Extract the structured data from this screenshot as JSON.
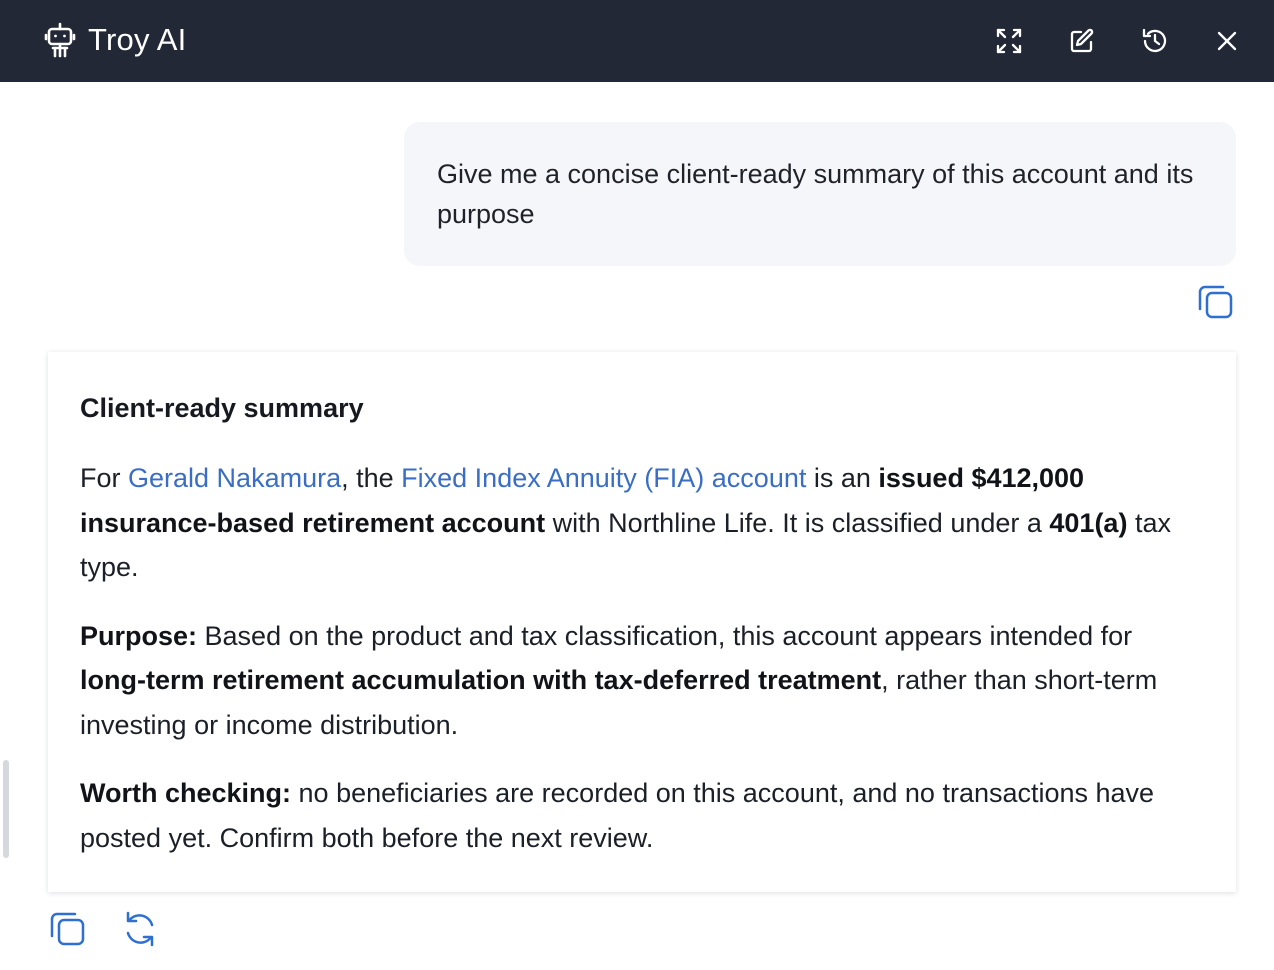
{
  "header": {
    "title": "Troy AI",
    "bg_color": "#222835",
    "icons": [
      "robot-icon",
      "expand-icon",
      "edit-icon",
      "history-icon",
      "close-icon"
    ]
  },
  "user_message": {
    "text": "Give me a concise client-ready summary of this account and its purpose"
  },
  "reply": {
    "heading": "Client-ready summary",
    "p1": {
      "t1": "For ",
      "client_link": "Gerald Nakamura",
      "t2": ", the ",
      "account_link": "Fixed Index Annuity (FIA) account",
      "t3": " is an ",
      "b1": "issued $412,000 insurance-based retirement account",
      "t4": " with Northline Life. It is classified under a ",
      "b2": "401(a)",
      "t5": " tax type."
    },
    "p2": {
      "label": "Purpose:",
      "t1": " Based on the product and tax classification, this account appears intended for ",
      "b1": "long-term retirement accumulation with tax-deferred treatment",
      "t2": ", rather than short-term investing or income distribution."
    },
    "p3": {
      "label": "Worth checking:",
      "t1": " no beneficiaries are recorded on this account, and no transactions have posted yet. Confirm both before the next review."
    }
  },
  "colors": {
    "link": "#3a6ec4",
    "icon_action": "#2f6fd0",
    "bubble_bg": "#f5f6fa"
  }
}
